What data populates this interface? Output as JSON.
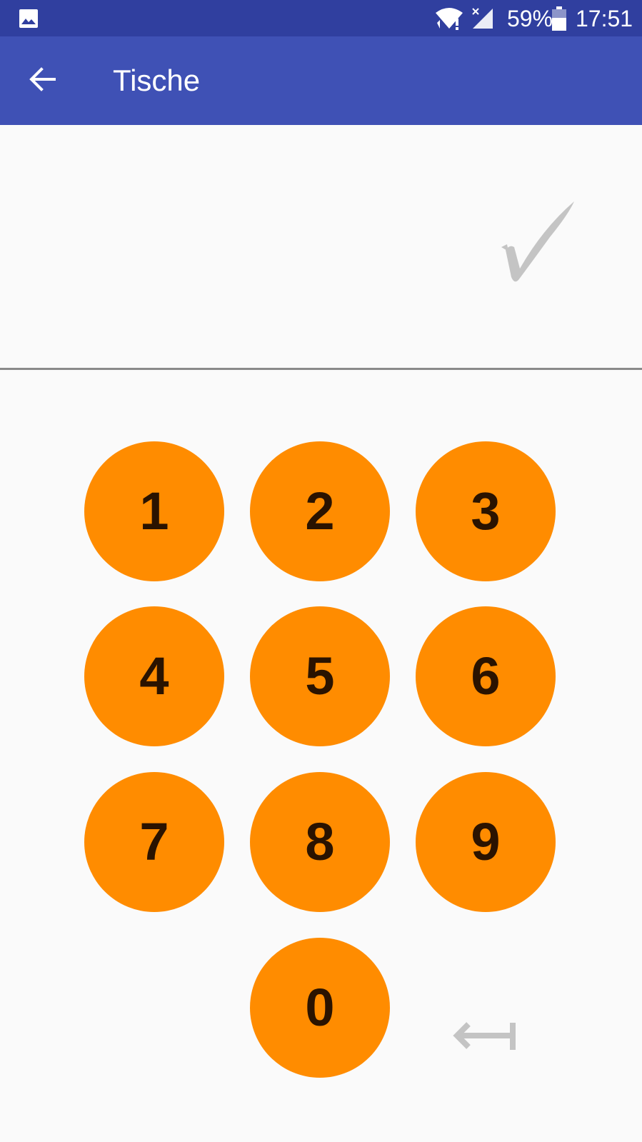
{
  "status_bar": {
    "notification_icon": "gallery-icon",
    "wifi_icon": "wifi-icon",
    "signal_icon": "no-signal-icon",
    "battery_percent": "59%",
    "battery_icon": "battery-icon",
    "time": "17:51"
  },
  "app_bar": {
    "back_icon": "arrow-back-icon",
    "title": "Tische",
    "color": "#3f51b5"
  },
  "display": {
    "value": "",
    "confirm_icon": "checkmark-icon"
  },
  "keypad": {
    "key_color": "#ff8c00",
    "keys": [
      "1",
      "2",
      "3",
      "4",
      "5",
      "6",
      "7",
      "8",
      "9",
      "0"
    ],
    "backspace_icon": "backspace-arrow-icon"
  }
}
